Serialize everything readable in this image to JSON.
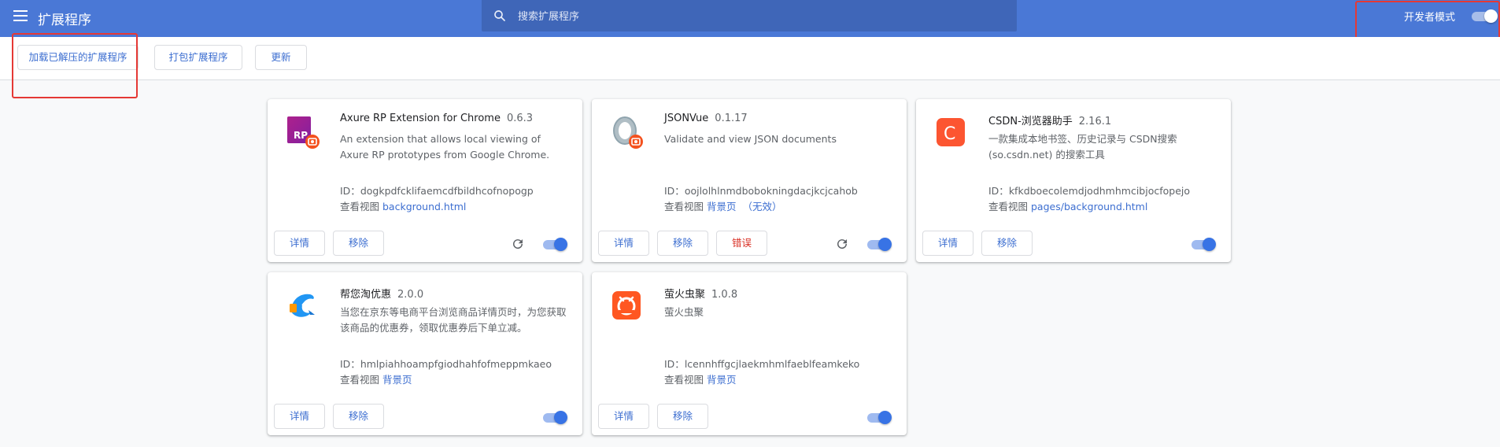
{
  "header": {
    "title": "扩展程序",
    "search_placeholder": "搜索扩展程序",
    "dev_mode_label": "开发者模式",
    "dev_mode_on": true
  },
  "toolbar": {
    "load_unpacked": "加载已解压的扩展程序",
    "pack_extension": "打包扩展程序",
    "update": "更新"
  },
  "common": {
    "details_label": "详情",
    "remove_label": "移除",
    "errors_label": "错误",
    "id_prefix": "ID：",
    "inspect_views_label": "查看视图",
    "reload_icon": "reload-icon",
    "accent_color": "#3873e5"
  },
  "extensions": [
    {
      "name": "Axure RP Extension for Chrome",
      "version": "0.6.3",
      "description": "An extension that allows local viewing of Axure RP prototypes from Google Chrome.",
      "id": "dogkpdfcklifaemcdfbildhcofnopogp",
      "view": "background.html",
      "view_status": "",
      "enabled": true,
      "has_errors": false,
      "icon": "axure-icon"
    },
    {
      "name": "JSONVue",
      "version": "0.1.17",
      "description": "Validate and view JSON documents",
      "id": "oojlolhlnmdbobokningdacjkcjcahob",
      "view": "背景页",
      "view_status": "（无效）",
      "enabled": true,
      "has_errors": true,
      "icon": "jsonvue-icon"
    },
    {
      "name": "CSDN-浏览器助手",
      "version": "2.16.1",
      "description": "一款集成本地书签、历史记录与 CSDN搜索(so.csdn.net) 的搜索工具",
      "id": "kfkdboecolemdjodhmhmcibjocfopejo",
      "view": "pages/background.html",
      "view_status": "",
      "enabled": true,
      "has_errors": false,
      "icon": "csdn-icon"
    },
    {
      "name": "帮您淘优惠",
      "version": "2.0.0",
      "description": "当您在京东等电商平台浏览商品详情页时，为您获取该商品的优惠券，领取优惠券后下单立减。",
      "id": "hmlpiahhoampfgiodhahfofmeppmkaeo",
      "view": "背景页",
      "view_status": "",
      "enabled": true,
      "has_errors": false,
      "icon": "dolphin-icon"
    },
    {
      "name": "萤火虫聚",
      "version": "1.0.8",
      "description": "萤火虫聚",
      "id": "lcennhffgcjlaekmhmlfaeblfeamkeko",
      "view": "背景页",
      "view_status": "",
      "enabled": true,
      "has_errors": false,
      "icon": "firefly-icon"
    }
  ]
}
